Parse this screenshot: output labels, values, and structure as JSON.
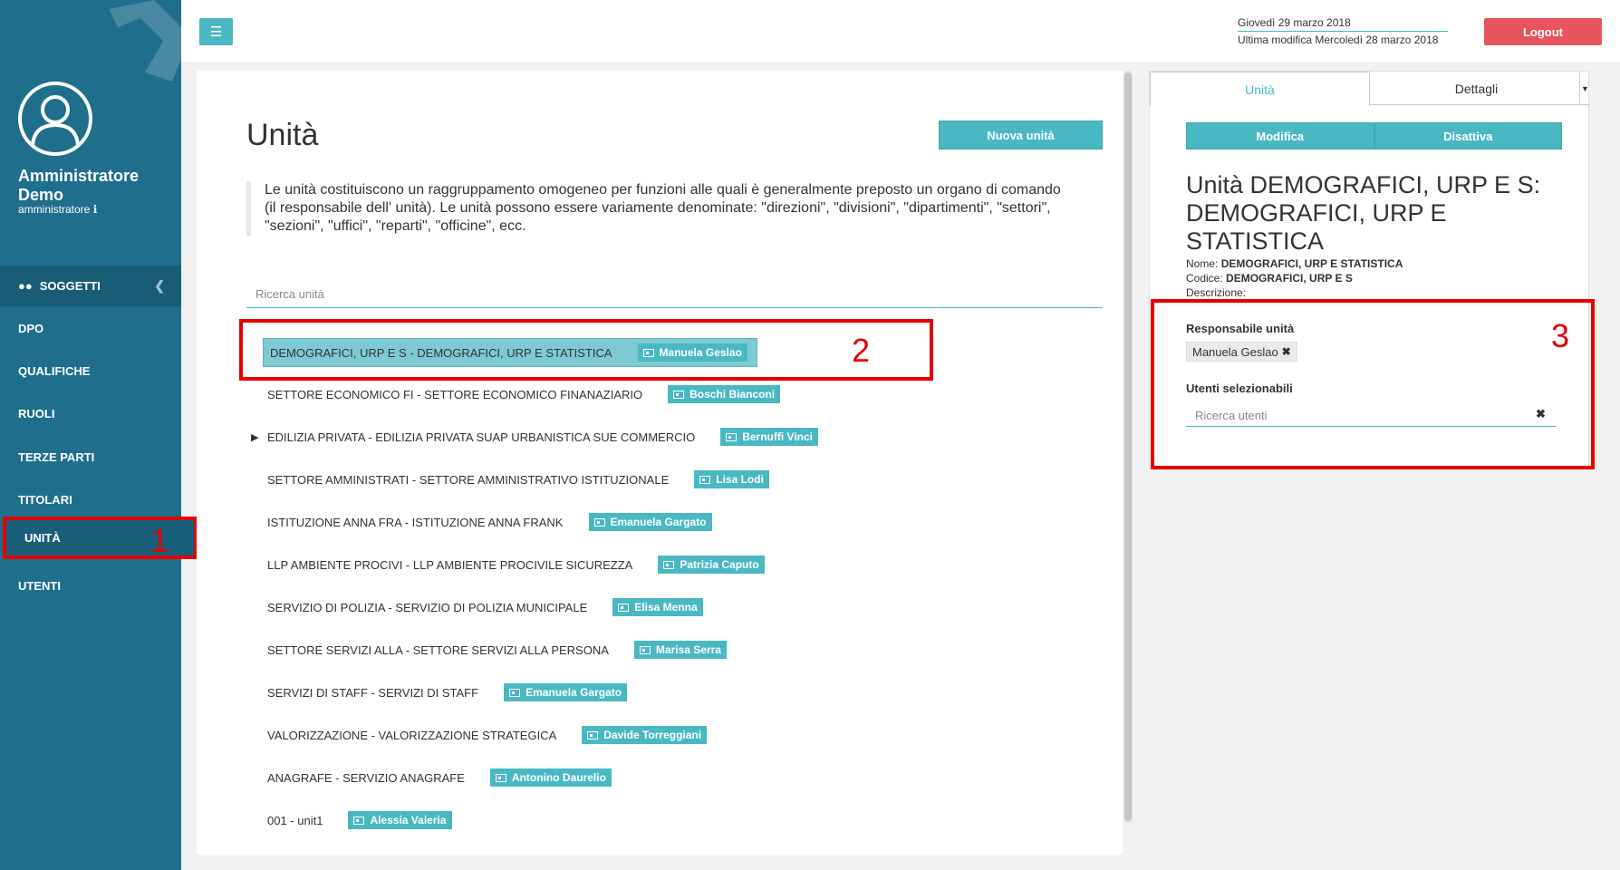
{
  "sidebar": {
    "user_name": "Amministratore Demo",
    "user_role": "amministratore ℹ",
    "section_label": "SOGGETTI",
    "items": [
      {
        "label": "DPO"
      },
      {
        "label": "QUALIFICHE"
      },
      {
        "label": "RUOLI"
      },
      {
        "label": "TERZE PARTI"
      },
      {
        "label": "TITOLARI"
      },
      {
        "label": "UNITÀ"
      },
      {
        "label": "UTENTI"
      }
    ]
  },
  "header": {
    "date": "Giovedì 29 marzo 2018",
    "last_modified": "Ultima modifica Mercoledì 28 marzo 2018",
    "logout_label": "Logout"
  },
  "main": {
    "title": "Unità",
    "new_button": "Nuova unità",
    "description": "Le unità costituiscono un raggruppamento omogeneo per funzioni alle quali è generalmente preposto un organo di comando (il responsabile dell' unità). Le unità possono essere variamente denominate: \"direzioni\", \"divisioni\", \"dipartimenti\", \"settori\", \"sezioni\", \"uffici\", \"reparti\", \"officine\", ecc.",
    "search_placeholder": "Ricerca unità",
    "units": [
      {
        "name": "DEMOGRAFICI, URP E S - DEMOGRAFICI, URP E STATISTICA",
        "responsible": "Manuela Geslao"
      },
      {
        "name": "SETTORE ECONOMICO FI - SETTORE ECONOMICO FINANAZIARIO",
        "responsible": "Boschi Bianconi"
      },
      {
        "name": "EDILIZIA PRIVATA - EDILIZIA PRIVATA SUAP URBANISTICA SUE COMMERCIO",
        "responsible": "Bernuffi Vinci"
      },
      {
        "name": "SETTORE AMMINISTRATI - SETTORE AMMINISTRATIVO ISTITUZIONALE",
        "responsible": "Lisa Lodi"
      },
      {
        "name": "ISTITUZIONE ANNA FRA - ISTITUZIONE ANNA FRANK",
        "responsible": "Emanuela Gargato"
      },
      {
        "name": "LLP AMBIENTE PROCIVI - LLP AMBIENTE PROCIVILE SICUREZZA",
        "responsible": "Patrizia Caputo"
      },
      {
        "name": "SERVIZIO DI POLIZIA - SERVIZIO DI POLIZIA MUNICIPALE",
        "responsible": "Elisa Menna"
      },
      {
        "name": "SETTORE SERVIZI ALLA - SETTORE SERVIZI ALLA PERSONA",
        "responsible": "Marisa Serra"
      },
      {
        "name": "SERVIZI DI STAFF - SERVIZI DI STAFF",
        "responsible": "Emanuela Gargato"
      },
      {
        "name": "VALORIZZAZIONE - VALORIZZAZIONE STRATEGICA",
        "responsible": "Davide Torreggiani"
      },
      {
        "name": "ANAGRAFE - SERVIZIO ANAGRAFE",
        "responsible": "Antonino Daurelio"
      },
      {
        "name": "001 - unit1",
        "responsible": "Alessia Valeria"
      }
    ]
  },
  "detail": {
    "tabs": [
      {
        "label": "Unità"
      },
      {
        "label": "Dettagli"
      }
    ],
    "edit_button": "Modifica",
    "disable_button": "Disattiva",
    "title": "Unità DEMOGRAFICI, URP E S: DEMOGRAFICI, URP E STATISTICA",
    "name_label": "Nome:",
    "name_value": "DEMOGRAFICI, URP E STATISTICA",
    "code_label": "Codice:",
    "code_value": "DEMOGRAFICI, URP E S",
    "description_label": "Descrizione:",
    "responsible_label": "Responsabile unità",
    "responsible_tag": "Manuela Geslao",
    "users_label": "Utenti selezionabili",
    "users_placeholder": "Ricerca utenti"
  },
  "annotations": [
    "1",
    "2",
    "3"
  ],
  "colors": {
    "sidebar": "#1f6e8c",
    "accent": "#4ab8c3",
    "logout": "#e8545d",
    "annotation": "#e60000"
  }
}
